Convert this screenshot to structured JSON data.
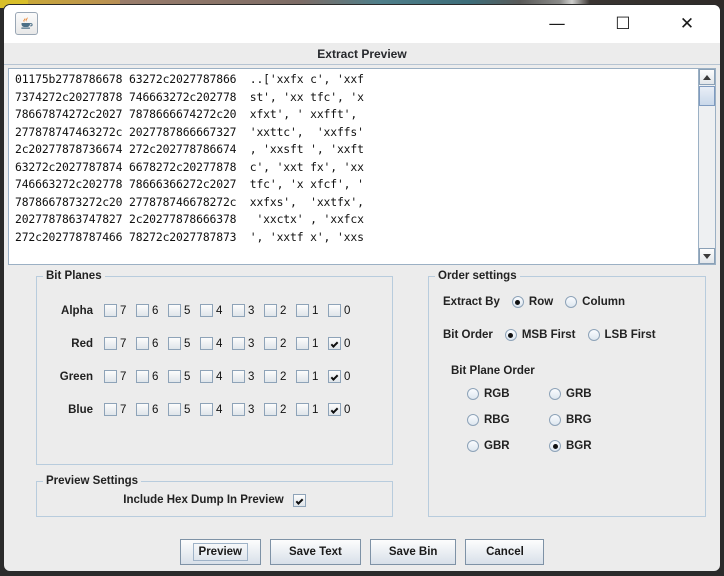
{
  "window": {
    "app_icon": "java-coffee-cup-icon",
    "minimize_label": "—",
    "maximize_label": "☐",
    "close_label": "✕"
  },
  "dialog": {
    "header_title": "Extract Preview"
  },
  "preview": {
    "hex_lines": "01175b2778786678 63272c2027787866  ..['xxfx c', 'xxf\n7374272c20277878 746663272c202778  st', 'xx tfc', 'x\n78667874272c2027 7878666674272c20  xfxt', ' xxfft',\n277878747463272c 2027787866667327  'xxttc',  'xxffs'\n2c20277878736674 272c202778786674  , 'xxsft ', 'xxft\n63272c2027787874 6678272c20277878  c', 'xxt fx', 'xx\n746663272c202778 78666366272c2027  tfc', 'x xfcf', '\n7878667873272c20 277878746678272c  xxfxs',  'xxtfx',\n2027787863747827 2c20277878666378   'xxctx' , 'xxfcx\n272c202778787466 78272c2027787873  ', 'xxtf x', 'xxs",
    "scrollbar": {
      "up_arrow": "scroll-up-arrow",
      "down_arrow": "scroll-down-arrow"
    }
  },
  "bit_planes": {
    "legend": "Bit Planes",
    "bits": [
      "7",
      "6",
      "5",
      "4",
      "3",
      "2",
      "1",
      "0"
    ],
    "rows": [
      {
        "label": "Alpha",
        "checked": [
          false,
          false,
          false,
          false,
          false,
          false,
          false,
          false
        ]
      },
      {
        "label": "Red",
        "checked": [
          false,
          false,
          false,
          false,
          false,
          false,
          false,
          true
        ]
      },
      {
        "label": "Green",
        "checked": [
          false,
          false,
          false,
          false,
          false,
          false,
          false,
          true
        ]
      },
      {
        "label": "Blue",
        "checked": [
          false,
          false,
          false,
          false,
          false,
          false,
          false,
          true
        ]
      }
    ]
  },
  "preview_settings": {
    "legend": "Preview Settings",
    "include_hex_dump_label": "Include Hex Dump In Preview",
    "include_hex_dump_checked": true
  },
  "order_settings": {
    "legend": "Order settings",
    "extract_by_label": "Extract By",
    "extract_by_options": [
      {
        "label": "Row",
        "selected": true
      },
      {
        "label": "Column",
        "selected": false
      }
    ],
    "bit_order_label": "Bit Order",
    "bit_order_options": [
      {
        "label": "MSB First",
        "selected": true
      },
      {
        "label": "LSB First",
        "selected": false
      }
    ],
    "bit_plane_order_label": "Bit Plane Order",
    "bit_plane_order_options": [
      {
        "label": "RGB",
        "selected": false
      },
      {
        "label": "GRB",
        "selected": false
      },
      {
        "label": "RBG",
        "selected": false
      },
      {
        "label": "BRG",
        "selected": false
      },
      {
        "label": "GBR",
        "selected": false
      },
      {
        "label": "BGR",
        "selected": true
      }
    ]
  },
  "buttons": [
    {
      "label": "Preview",
      "focused": true
    },
    {
      "label": "Save Text",
      "focused": false
    },
    {
      "label": "Save Bin",
      "focused": false
    },
    {
      "label": "Cancel",
      "focused": false
    }
  ],
  "colors": {
    "window_bg": "#ececec",
    "panel_border": "#b8ccdd",
    "text": "#222222",
    "field_bg": "#ffffff"
  }
}
